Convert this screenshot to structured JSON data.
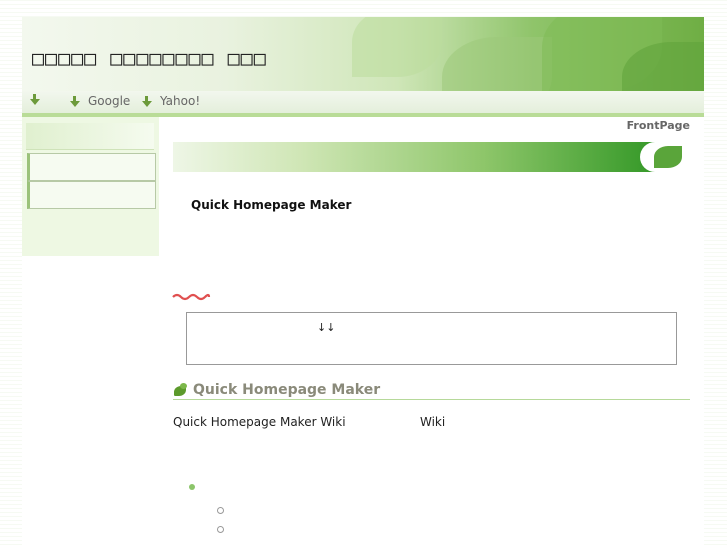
{
  "header": {
    "title": "□□□□□ □□□□□□□□ □□□"
  },
  "nav": {
    "items": [
      {
        "label": ""
      },
      {
        "label": "Google"
      },
      {
        "label": "Yahoo!"
      }
    ]
  },
  "page": {
    "frontpage_label": "FrontPage",
    "intro_text": "Quick Homepage Maker",
    "notice_text": "↓↓",
    "section_title": "Quick Homepage Maker",
    "body_text_1": "Quick Homepage Maker  Wiki",
    "body_text_2": "Wiki"
  },
  "colors": {
    "accent": "#6c9a3a",
    "section_rule": "#b6d99a",
    "bullet": "#8cc56a"
  },
  "icons": [
    "arrow-down-icon",
    "leaf-icon",
    "bullet-icon"
  ]
}
